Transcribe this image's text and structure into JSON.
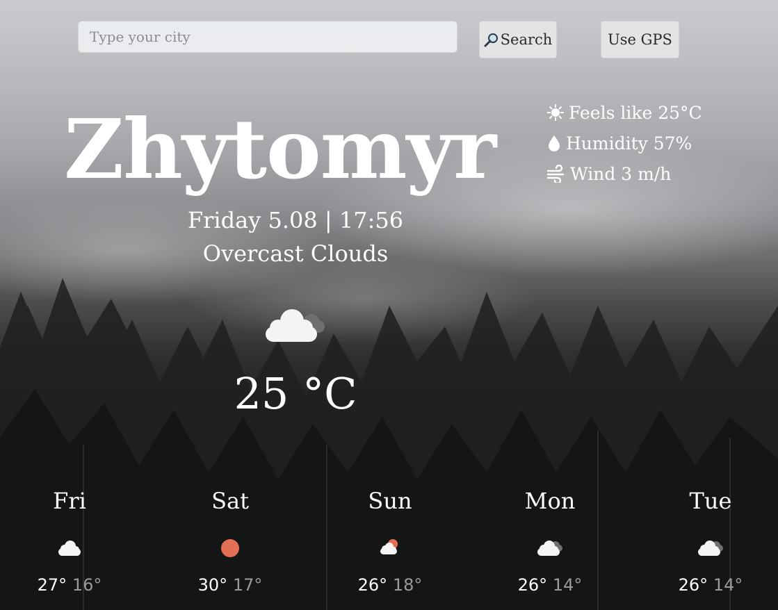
{
  "search": {
    "placeholder": "Type your city",
    "value": ""
  },
  "buttons": {
    "search_label": "Search",
    "gps_label": "Use GPS"
  },
  "current": {
    "city": "Zhytomyr",
    "datetime": "Friday 5.08 | 17:56",
    "condition": "Overcast Clouds",
    "temperature": "25 °C",
    "icon": "overcast-cloud-icon"
  },
  "details": {
    "feels_like": "Feels like 25°C",
    "humidity": "Humidity 57%",
    "wind": "Wind 3 m/h"
  },
  "forecast": [
    {
      "day": "Fri",
      "high": "27°",
      "low": "16°",
      "icon": "cloud-icon"
    },
    {
      "day": "Sat",
      "high": "30°",
      "low": "17°",
      "icon": "sun-icon"
    },
    {
      "day": "Sun",
      "high": "26°",
      "low": "18°",
      "icon": "partly-cloudy-icon"
    },
    {
      "day": "Mon",
      "high": "26°",
      "low": "14°",
      "icon": "overcast-cloud-icon"
    },
    {
      "day": "Tue",
      "high": "26°",
      "low": "14°",
      "icon": "overcast-cloud-icon"
    }
  ],
  "colors": {
    "sun": "#e36f55",
    "button_bg": "#e2e4e6",
    "low_temp": "#9a9c9c"
  }
}
